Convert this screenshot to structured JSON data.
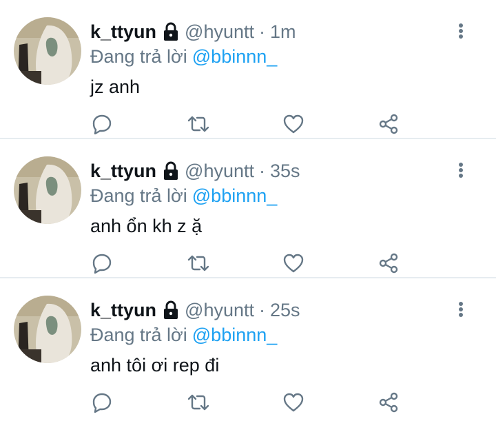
{
  "tweets": [
    {
      "display_name": "k_ttyun",
      "handle": "@hyuntt",
      "separator": "·",
      "time": "1m",
      "reply_prefix": "Đang trả lời",
      "reply_target": "@bbinnn_",
      "text": "jz anh",
      "icons": [
        "avatar",
        "lock-icon",
        "more-icon",
        "reply-icon",
        "retweet-icon",
        "like-icon",
        "share-icon"
      ]
    },
    {
      "display_name": "k_ttyun",
      "handle": "@hyuntt",
      "separator": "·",
      "time": "35s",
      "reply_prefix": "Đang trả lời",
      "reply_target": "@bbinnn_",
      "text": "anh ổn kh z ặ",
      "icons": [
        "avatar",
        "lock-icon",
        "more-icon",
        "reply-icon",
        "retweet-icon",
        "like-icon",
        "share-icon"
      ]
    },
    {
      "display_name": "k_ttyun",
      "handle": "@hyuntt",
      "separator": "·",
      "time": "25s",
      "reply_prefix": "Đang trả lời",
      "reply_target": "@bbinnn_",
      "text": "anh tôi ơi rep đi",
      "icons": [
        "avatar",
        "lock-icon",
        "more-icon",
        "reply-icon",
        "retweet-icon",
        "like-icon",
        "share-icon"
      ]
    }
  ],
  "colors": {
    "text": "#0f1419",
    "secondary": "#657786",
    "link": "#1da1f2",
    "divider": "#e6ecf0"
  }
}
